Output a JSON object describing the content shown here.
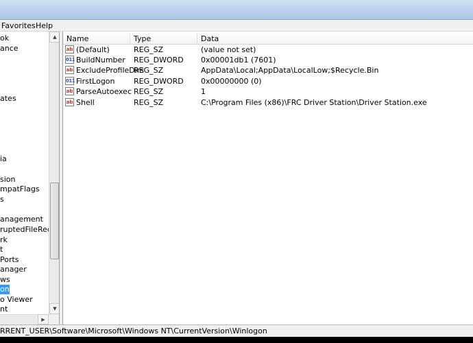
{
  "menu": {
    "favorites": "Favorites",
    "help": "Help"
  },
  "tree": {
    "items": [
      "ok",
      "ance",
      "ates",
      "ia",
      "sion",
      "mpatFlags",
      "s",
      "anagement",
      "ruptedFileRecove",
      "rk",
      "t",
      "Ports",
      "anager",
      "ws",
      "on",
      "o Viewer",
      "nt"
    ]
  },
  "list": {
    "columns": {
      "name": "Name",
      "type": "Type",
      "data": "Data"
    },
    "rows": [
      {
        "icon": "string-value-icon",
        "name": "(Default)",
        "type": "REG_SZ",
        "data": "(value not set)"
      },
      {
        "icon": "dword-value-icon",
        "name": "BuildNumber",
        "type": "REG_DWORD",
        "data": "0x00001db1 (7601)"
      },
      {
        "icon": "string-value-icon",
        "name": "ExcludeProfileDirs",
        "type": "REG_SZ",
        "data": "AppData\\Local;AppData\\LocalLow;$Recycle.Bin"
      },
      {
        "icon": "dword-value-icon",
        "name": "FirstLogon",
        "type": "REG_DWORD",
        "data": "0x00000000 (0)"
      },
      {
        "icon": "string-value-icon",
        "name": "ParseAutoexec",
        "type": "REG_SZ",
        "data": "1"
      },
      {
        "icon": "string-value-icon",
        "name": "Shell",
        "type": "REG_SZ",
        "data": "C:\\Program Files (x86)\\FRC Driver Station\\Driver Station.exe"
      }
    ]
  },
  "status": {
    "path": "RRENT_USER\\Software\\Microsoft\\Windows NT\\CurrentVersion\\Winlogon"
  },
  "colors": {
    "selection": "#3399ff",
    "titlebar": "#b9d1ee"
  }
}
